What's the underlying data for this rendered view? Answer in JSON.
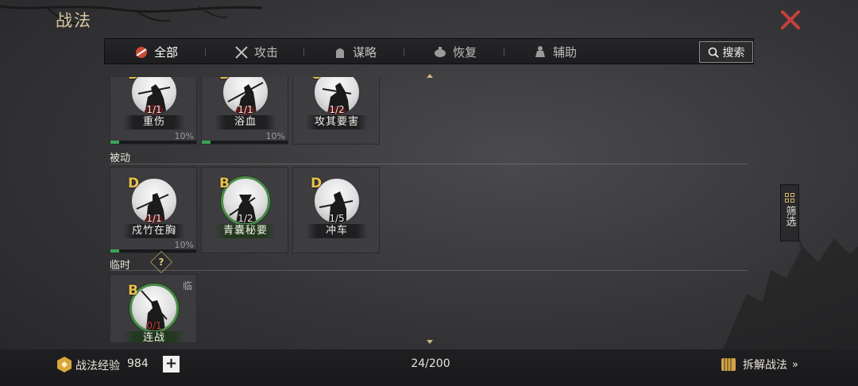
{
  "header": {
    "title": "战法"
  },
  "tabs": [
    {
      "label": "全部",
      "icon": "all-skills-icon",
      "active": true
    },
    {
      "label": "攻击",
      "icon": "crossed-swords-icon",
      "active": false
    },
    {
      "label": "谋略",
      "icon": "strategy-icon",
      "active": false
    },
    {
      "label": "恢复",
      "icon": "recovery-icon",
      "active": false
    },
    {
      "label": "辅助",
      "icon": "support-icon",
      "active": false
    }
  ],
  "search": {
    "label": "搜索"
  },
  "sections": {
    "top": {
      "cards": [
        {
          "grade": "D",
          "level": "1/1",
          "name": "重伤",
          "percent": "10%",
          "progress": 0.1
        },
        {
          "grade": "D",
          "level": "1/1",
          "name": "浴血",
          "percent": "10%",
          "progress": 0.1
        },
        {
          "grade": "C",
          "level": "1/2",
          "name": "攻其要害"
        }
      ]
    },
    "passive": {
      "label": "被动",
      "cards": [
        {
          "grade": "D",
          "level": "1/1",
          "name": "戍竹在胸",
          "percent": "10%",
          "progress": 0.1
        },
        {
          "grade": "B",
          "level": "1/2",
          "name": "青囊秘要"
        },
        {
          "grade": "D",
          "level": "1/5",
          "name": "冲车"
        }
      ]
    },
    "temporary": {
      "label": "临时",
      "help": "?",
      "cards": [
        {
          "grade": "B",
          "level": "0/1",
          "name": "连战",
          "tag": "临"
        }
      ]
    }
  },
  "filter": {
    "label": "筛选"
  },
  "footer": {
    "exp_label": "战法经验",
    "exp_value": "984",
    "plus": "+",
    "count": "24/200",
    "dismantle_label": "拆解战法",
    "dismantle_arrow": "»"
  },
  "colors": {
    "grade": "#e8c04a",
    "accent_gold": "#d8c8a0",
    "close_red": "#c8403c",
    "progress_green": "#3aa457"
  }
}
